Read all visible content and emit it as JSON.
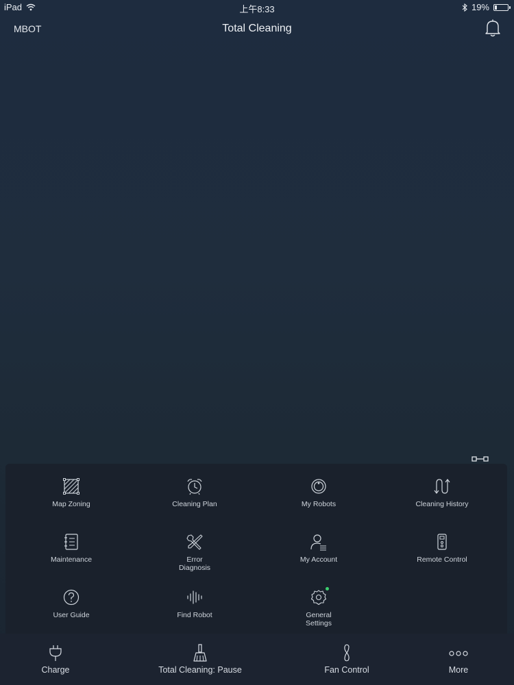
{
  "status_bar": {
    "device": "iPad",
    "time": "上午8:33",
    "battery_text": "19%",
    "battery_level": 0.19
  },
  "nav": {
    "left_label": "MBOT",
    "title": "Total Cleaning"
  },
  "menu": {
    "items": [
      {
        "label": "Map Zoning",
        "icon": "map-zoning-icon"
      },
      {
        "label": "Cleaning Plan",
        "icon": "alarm-clock-icon"
      },
      {
        "label": "My Robots",
        "icon": "robot-icon"
      },
      {
        "label": "Cleaning History",
        "icon": "history-path-icon"
      },
      {
        "label": "Maintenance",
        "icon": "notebook-icon"
      },
      {
        "label": "Error\nDiagnosis",
        "icon": "tools-icon"
      },
      {
        "label": "My Account",
        "icon": "account-icon"
      },
      {
        "label": "Remote Control",
        "icon": "remote-icon"
      },
      {
        "label": "User Guide",
        "icon": "question-icon"
      },
      {
        "label": "Find Robot",
        "icon": "sound-wave-icon"
      },
      {
        "label": "General\nSettings",
        "icon": "settings-gear-icon"
      }
    ]
  },
  "tabs": [
    {
      "label": "Charge",
      "icon": "plug-icon"
    },
    {
      "label": "Total Cleaning: Pause",
      "icon": "broom-icon"
    },
    {
      "label": "Fan Control",
      "icon": "fan-icon"
    },
    {
      "label": "More",
      "icon": "more-dots-icon"
    }
  ],
  "colors": {
    "background": "#1f2d3d",
    "panel": "#1a212c",
    "tab_bar": "#1c2330",
    "text": "#d8dde4",
    "badge": "#3ccf6e"
  }
}
